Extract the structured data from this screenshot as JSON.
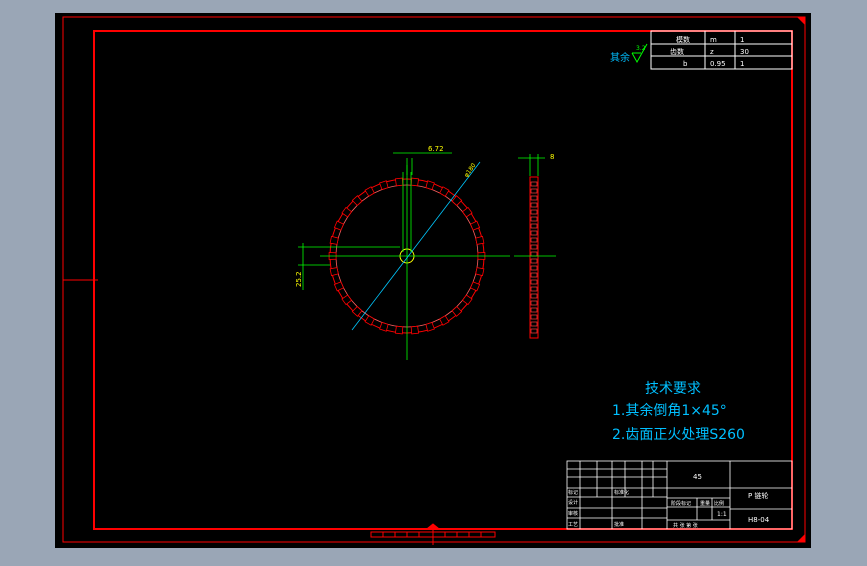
{
  "colors": {
    "background": "#9aa6b6",
    "canvas": "#000000",
    "frame": "#ff0000",
    "table_lines": "#ffffff",
    "dimension": "#00ff00",
    "centerline": "#00c8ff",
    "tech_text": "#00bfff",
    "dimension_text": "#ffff00"
  },
  "roughness": {
    "label": "其余",
    "value": "3.2"
  },
  "gear_params": {
    "rows": [
      [
        "模数",
        "m",
        "1"
      ],
      [
        "齿数",
        "z",
        "30"
      ],
      [
        "b",
        "0.95",
        "1"
      ]
    ]
  },
  "dimensions": {
    "top_width": "6.72",
    "diameter": "φ180",
    "left_height": "25.2",
    "side_width": "8"
  },
  "tech_requirements": {
    "title": "技术要求",
    "line1": "1.其余倒角1×45°",
    "line2": "2.齿面正火处理S260"
  },
  "title_block": {
    "material": "45",
    "part_name": "P 链轮",
    "drawing_no": "H8-04",
    "scale": "1:1",
    "left_labels": [
      "标记",
      "设计",
      "审核",
      "工艺"
    ],
    "mid_labels": [
      "标准化",
      "批准"
    ],
    "stage_label": "阶段标记",
    "weight_label": "重量",
    "scale_label": "比例",
    "sheet_text": "共 张 第 张"
  }
}
